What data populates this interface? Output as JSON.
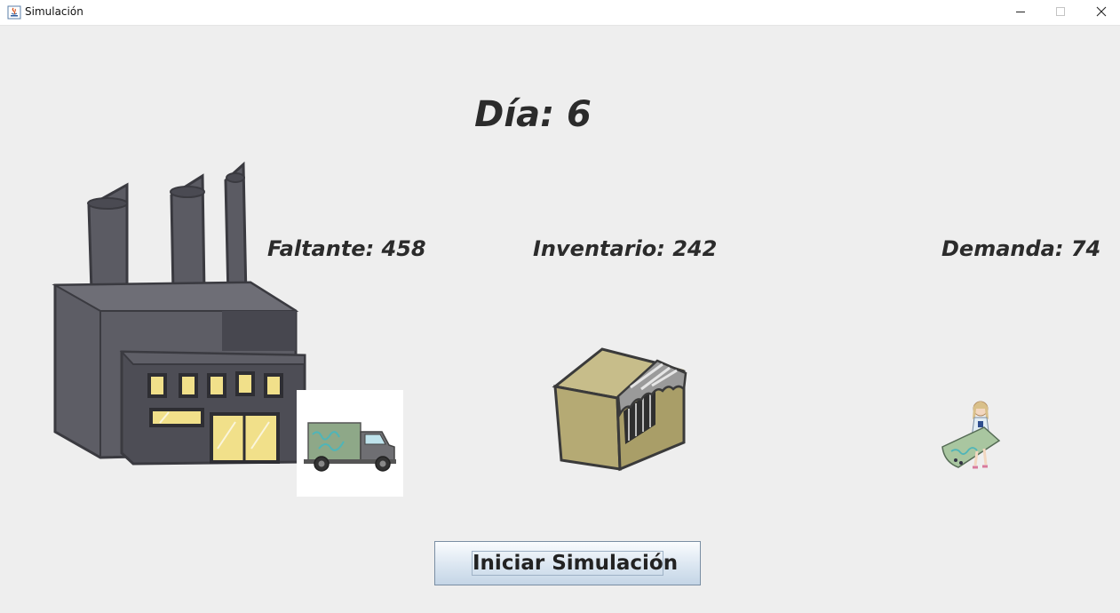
{
  "window": {
    "title": "Simulación",
    "controls": {
      "minimize_icon": "minimize-icon",
      "maximize_icon": "maximize-icon",
      "close_icon": "close-icon"
    }
  },
  "simulation": {
    "day": "Día: 6",
    "faltante": "Faltante: 458",
    "inventario": "Inventario: 242",
    "demanda": "Demanda: 74"
  },
  "images": {
    "factory": "factory-image",
    "truck": "truck-image",
    "store": "store-image",
    "customer": "customer-image"
  },
  "button": {
    "start_label": "Iniciar Simulación"
  },
  "colors": {
    "background": "#eeeeee",
    "text": "#2b2b2b",
    "factory_body": "#55555d",
    "factory_window": "#f1e08a",
    "store_box": "#b8ad78",
    "truck_cargo": "#8ea888",
    "button_border": "#7a8ea3"
  }
}
